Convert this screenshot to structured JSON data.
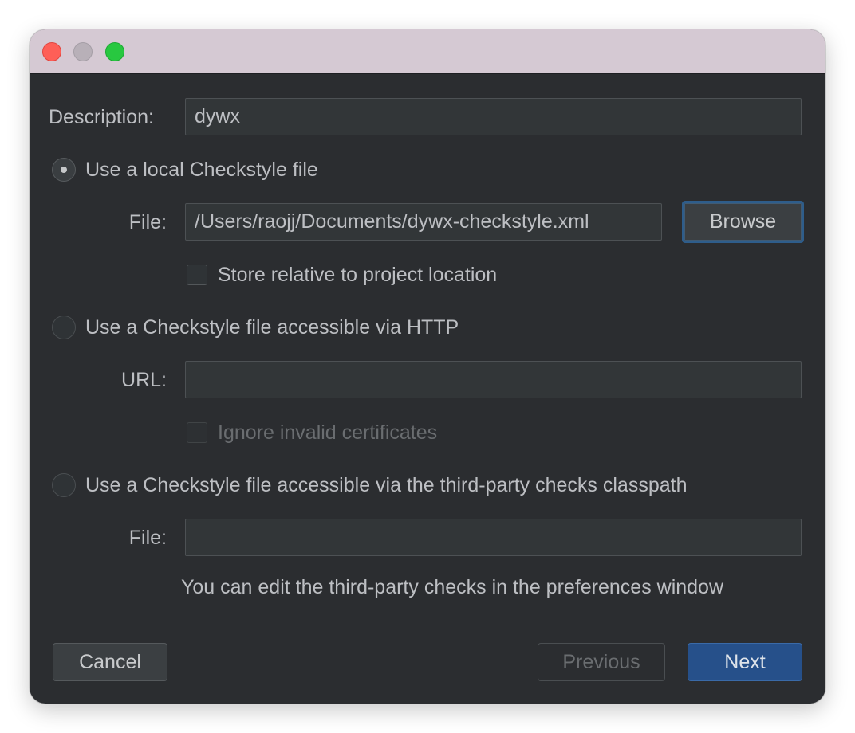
{
  "form": {
    "description_label": "Description:",
    "description_value": "dywx",
    "option_local": {
      "label": "Use a local Checkstyle file",
      "selected": true,
      "file_label": "File:",
      "file_value": "/Users/raojj/Documents/dywx-checkstyle.xml",
      "browse_label": "Browse",
      "store_relative_label": "Store relative to project location",
      "store_relative_checked": false
    },
    "option_http": {
      "label": "Use a Checkstyle file accessible via HTTP",
      "selected": false,
      "url_label": "URL:",
      "url_value": "",
      "ignore_certs_label": "Ignore invalid certificates",
      "ignore_certs_checked": false
    },
    "option_classpath": {
      "label": "Use a Checkstyle file accessible via the third-party checks classpath",
      "selected": false,
      "file_label": "File:",
      "file_value": "",
      "hint": "You can edit the third-party checks in the preferences window"
    }
  },
  "footer": {
    "cancel_label": "Cancel",
    "previous_label": "Previous",
    "next_label": "Next"
  },
  "colors": {
    "background": "#2b2d30",
    "titlebar": "#d5c9d3",
    "accent": "#26508a",
    "focus_ring": "#2e5d8b",
    "traffic_close": "#fe5f57",
    "traffic_minimize": "#b8b0b8",
    "traffic_maximize": "#28c840"
  }
}
